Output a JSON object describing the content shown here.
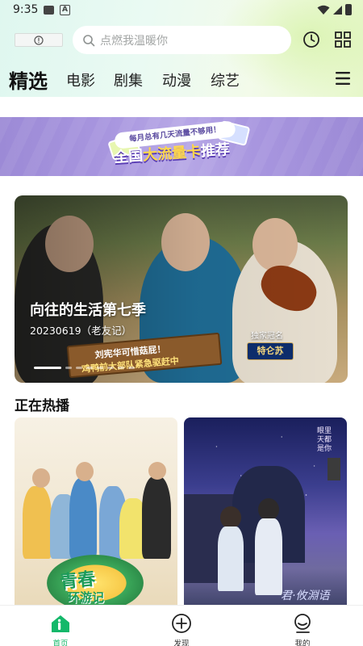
{
  "status_bar": {
    "time": "9:35",
    "icons": [
      "image-icon",
      "a-icon",
      "wifi-icon",
      "signal-icon",
      "battery-icon"
    ]
  },
  "header": {
    "notice_icon": "info-circle-icon",
    "search_placeholder": "点燃我温暖你",
    "right_icons": [
      "history-clock-icon",
      "grid-apps-icon"
    ]
  },
  "tabs": {
    "items": [
      "精选",
      "电影",
      "剧集",
      "动漫",
      "综艺"
    ],
    "active": "精选",
    "menu_icon": "hamburger-menu-icon"
  },
  "banner": {
    "bubble": "每月总有几天流量不够用！",
    "title_prefix": "全国",
    "title_highlight": "大流量卡",
    "title_suffix": "推荐"
  },
  "hero": {
    "title": "向往的生活第七季",
    "subtitle": "20230619（老友记）",
    "sign_line1": "刘宪华可惜菇屁！",
    "sign_line2": "鸡鸭前大部队紧急驱赶中",
    "sponsor_label": "独家冠名",
    "sponsor_name": "特仑苏",
    "carousel_total": 8,
    "carousel_active": 1
  },
  "section": {
    "title": "正在热播"
  },
  "cards": [
    {
      "logo_line1": "青春",
      "logo_line2": "环游记"
    },
    {
      "signature": "君·攸淵语",
      "vertical_text": "眼里天都是你"
    }
  ],
  "bottom_nav": [
    {
      "label": "首页",
      "icon": "home-icon",
      "active": true
    },
    {
      "label": "发现",
      "icon": "plus-circle-icon",
      "active": false
    },
    {
      "label": "我的",
      "icon": "chat-profile-icon",
      "active": false
    }
  ],
  "colors": {
    "accent": "#14b86a",
    "banner": "#a896df",
    "highlight": "#ffd84a"
  }
}
